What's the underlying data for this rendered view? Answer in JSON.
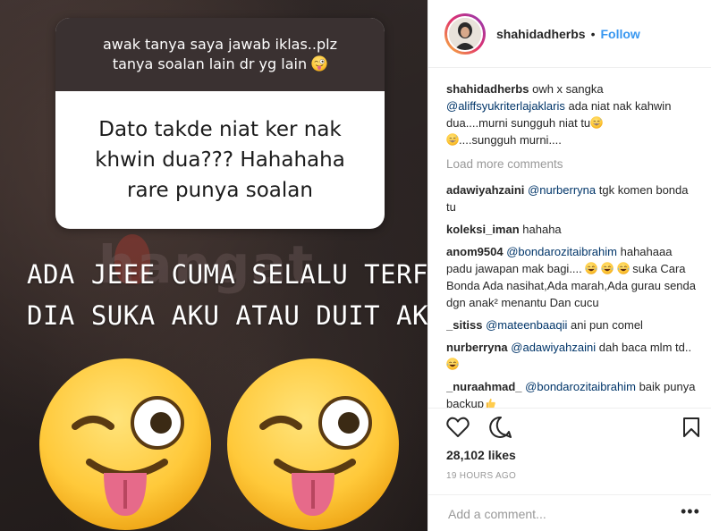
{
  "story": {
    "question_header_lines": [
      "awak tanya saya jawab iklas..plz",
      "tanya soalan lain dr yg lain"
    ],
    "question_body_lines": [
      "Dato takde niat ker nak",
      "khwin dua??? Hahahaha",
      "rare punya soalan"
    ],
    "watermark": "hangat",
    "answer_lines": [
      "ADA JEEE CUMA SELALU TERFIKIR",
      "DIA SUKA AKU ATAU DUIT AKU"
    ]
  },
  "header": {
    "username": "shahidadherbs",
    "separator": "•",
    "follow_label": "Follow"
  },
  "caption": {
    "username": "shahidadherbs",
    "text_1": "owh x sangka",
    "mention": "@aliffsyukriterlajaklaris",
    "text_2": "ada niat nak kahwin dua....murni sungguh niat tu",
    "text_3": "....sungguh murni...."
  },
  "load_more_label": "Load more comments",
  "comments": [
    {
      "user": "adawiyahzaini",
      "mention": "@nurberryna",
      "text": "tgk komen bonda tu"
    },
    {
      "user": "koleksi_iman",
      "mention": "",
      "text": "hahaha"
    },
    {
      "user": "anom9504",
      "mention": "@bondarozitaibrahim",
      "text_1": "hahahaaa padu jawapan mak bagi....",
      "text_2": "suka Cara Bonda Ada nasihat,Ada marah,Ada gurau senda dgn anak² menantu Dan cucu"
    },
    {
      "user": "_sitiss",
      "mention": "@mateenbaaqii",
      "text": "ani pun comel"
    },
    {
      "user": "nurberryna",
      "mention": "@adawiyahzaini",
      "text": "dah baca mlm td.."
    },
    {
      "user": "_nuraahmad_",
      "mention": "@bondarozitaibrahim",
      "text": "baik punya backup"
    }
  ],
  "actions": {
    "like_icon": "heart-icon",
    "comment_icon": "comment-icon",
    "save_icon": "bookmark-icon",
    "likes": "28,102 likes",
    "timestamp": "19 HOURS AGO"
  },
  "comment_input": {
    "placeholder": "Add a comment...",
    "more_label": "•••"
  },
  "colors": {
    "link": "#003569",
    "follow": "#3897f0",
    "muted": "#999999",
    "text": "#262626"
  }
}
